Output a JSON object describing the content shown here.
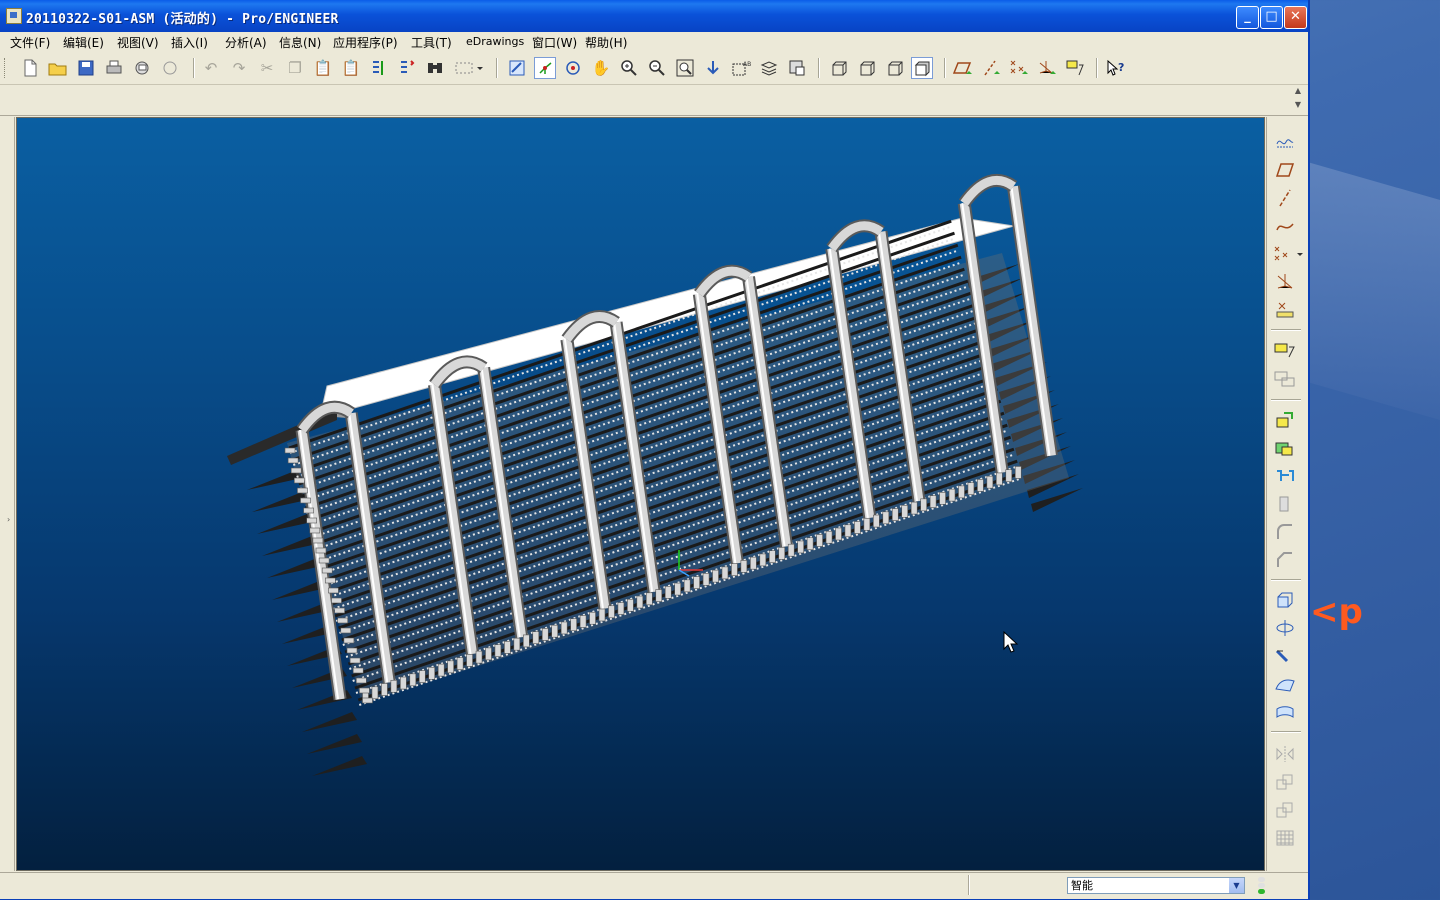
{
  "window": {
    "title": "20110322-S01-ASM (活动的) - Pro/ENGINEER",
    "controls": {
      "minimize": "_",
      "maximize": "□",
      "close": "✕"
    }
  },
  "menu": [
    "文件(F)",
    "编辑(E)",
    "视图(V)",
    "插入(I)",
    "分析(A)",
    "信息(N)",
    "应用程序(P)",
    "工具(T)",
    "eDrawings",
    "窗口(W)",
    "帮助(H)"
  ],
  "toolbar_icons": [
    "new-file-icon",
    "open-folder-icon",
    "save-icon",
    "print-icon",
    "email-icon",
    "send-icon",
    "undo-icon",
    "redo-icon",
    "cut-icon",
    "copy-icon",
    "paste-icon",
    "paste-special-icon",
    "regenerate-icon",
    "regenerate-manager-icon",
    "find-icon",
    "selection-box-icon",
    "repaint-icon",
    "spin-center-icon",
    "orient-mode-icon",
    "pan-icon",
    "zoom-in-icon",
    "zoom-out-icon",
    "refit-icon",
    "reorient-icon",
    "saved-views-icon",
    "layers-icon",
    "view-manager-icon",
    "wireframe-icon",
    "hidden-line-icon",
    "no-hidden-icon",
    "shading-icon",
    "datum-planes-icon",
    "datum-axes-icon",
    "datum-points-icon",
    "coordinate-systems-icon",
    "annotations-icon",
    "context-help-icon"
  ],
  "right_toolbar_icons": [
    "datum-curve-sketch-icon",
    "datum-plane-icon",
    "datum-axis-icon",
    "datum-curve-icon",
    "datum-point-icon",
    "coordinate-system-icon",
    "analysis-feature-icon",
    "assemble-component-icon",
    "create-component-icon",
    "insert-shell-icon",
    "cut-icon",
    "skeleton-icon",
    "hole-icon",
    "round-icon",
    "chamfer-icon",
    "extrude-icon",
    "revolve-icon",
    "sweep-icon",
    "blend-icon",
    "surface-icon",
    "mirror-icon",
    "pattern-icon",
    "copy-feature-icon",
    "grid-icon"
  ],
  "status": {
    "filter_value": "智能",
    "traffic_light_colors": [
      "#e0e0e0",
      "#e0e0e0",
      "#2fb52f"
    ]
  },
  "colors": {
    "titlebar": "#0a52d9",
    "viewport_top": "#0a5fa2",
    "viewport_bottom": "#03203f",
    "model_tubes": "#d8d8d8"
  },
  "desktop": {
    "logo_fragment": "<p"
  }
}
